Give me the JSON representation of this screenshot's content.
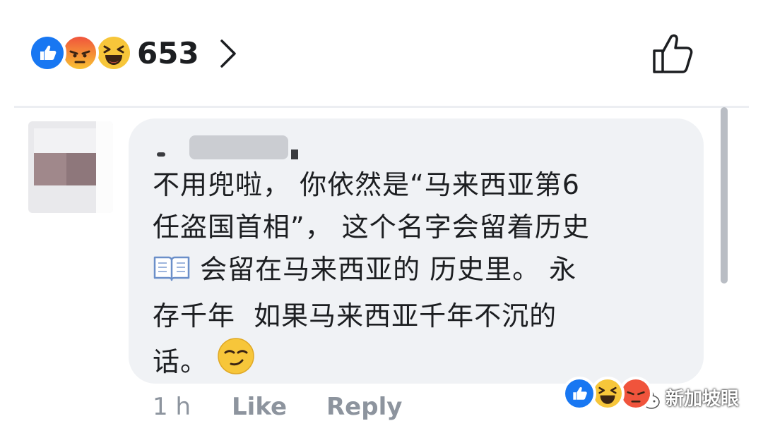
{
  "reaction_summary": {
    "reactions": [
      "like-reaction-icon",
      "angry-reaction-icon",
      "haha-reaction-icon"
    ],
    "count": "653"
  },
  "comment": {
    "author": "",
    "text_lines": [
      "不用兜啦， 你依然是“马来西亚第6",
      "任盗国首相”， 这个名字会留着历史",
      "会留在马来西亚的 历史里。 永",
      "存千年  如果马来西亚千年不沉的",
      "话。"
    ],
    "inline_icons": [
      "open-book-icon",
      "smirk-emoji-icon"
    ],
    "time": "1 h",
    "like_label": "Like",
    "reply_label": "Reply",
    "reactions": [
      "like-reaction-icon",
      "haha-reaction-icon",
      "angry-reaction-icon"
    ]
  },
  "watermark": {
    "text": "新加坡眼"
  },
  "colors": {
    "like_blue": "#1877f2",
    "bubble_bg": "#f0f2f5",
    "meta_gray": "#8d949e",
    "text": "#1c1e21"
  }
}
